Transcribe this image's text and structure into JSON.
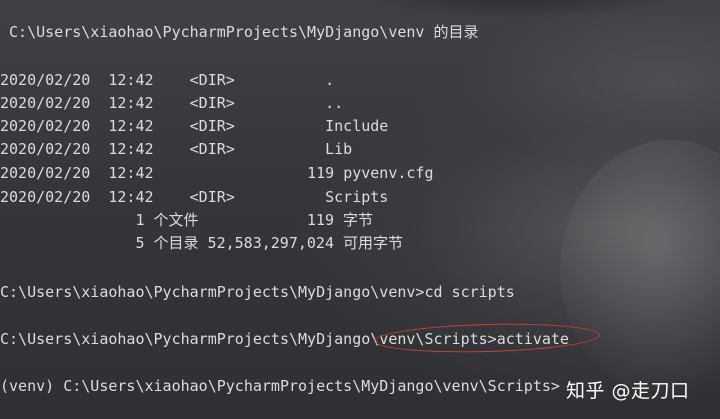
{
  "terminal": {
    "dir_header": " C:\\Users\\xiaohao\\PycharmProjects\\MyDjango\\venv 的目录",
    "entries": [
      {
        "date": "2020/02/20",
        "time": "12:42",
        "type": "<DIR>",
        "size": "",
        "name": "."
      },
      {
        "date": "2020/02/20",
        "time": "12:42",
        "type": "<DIR>",
        "size": "",
        "name": ".."
      },
      {
        "date": "2020/02/20",
        "time": "12:42",
        "type": "<DIR>",
        "size": "",
        "name": "Include"
      },
      {
        "date": "2020/02/20",
        "time": "12:42",
        "type": "<DIR>",
        "size": "",
        "name": "Lib"
      },
      {
        "date": "2020/02/20",
        "time": "12:42",
        "type": "",
        "size": "119",
        "name": "pyvenv.cfg"
      },
      {
        "date": "2020/02/20",
        "time": "12:42",
        "type": "<DIR>",
        "size": "",
        "name": "Scripts"
      }
    ],
    "summary_files": "               1 个文件            119 字节",
    "summary_dirs": "               5 个目录 52,583,297,024 可用字节",
    "cmd1": "C:\\Users\\xiaohao\\PycharmProjects\\MyDjango\\venv>cd scripts",
    "cmd2": "C:\\Users\\xiaohao\\PycharmProjects\\MyDjango\\venv\\Scripts>activate",
    "cmd3": "(venv) C:\\Users\\xiaohao\\PycharmProjects\\MyDjango\\venv\\Scripts>"
  },
  "watermark": "知乎 @走刀口",
  "colors": {
    "text": "#dcdcdc",
    "annotation": "#c8403c",
    "watermark": "#ffffff"
  }
}
